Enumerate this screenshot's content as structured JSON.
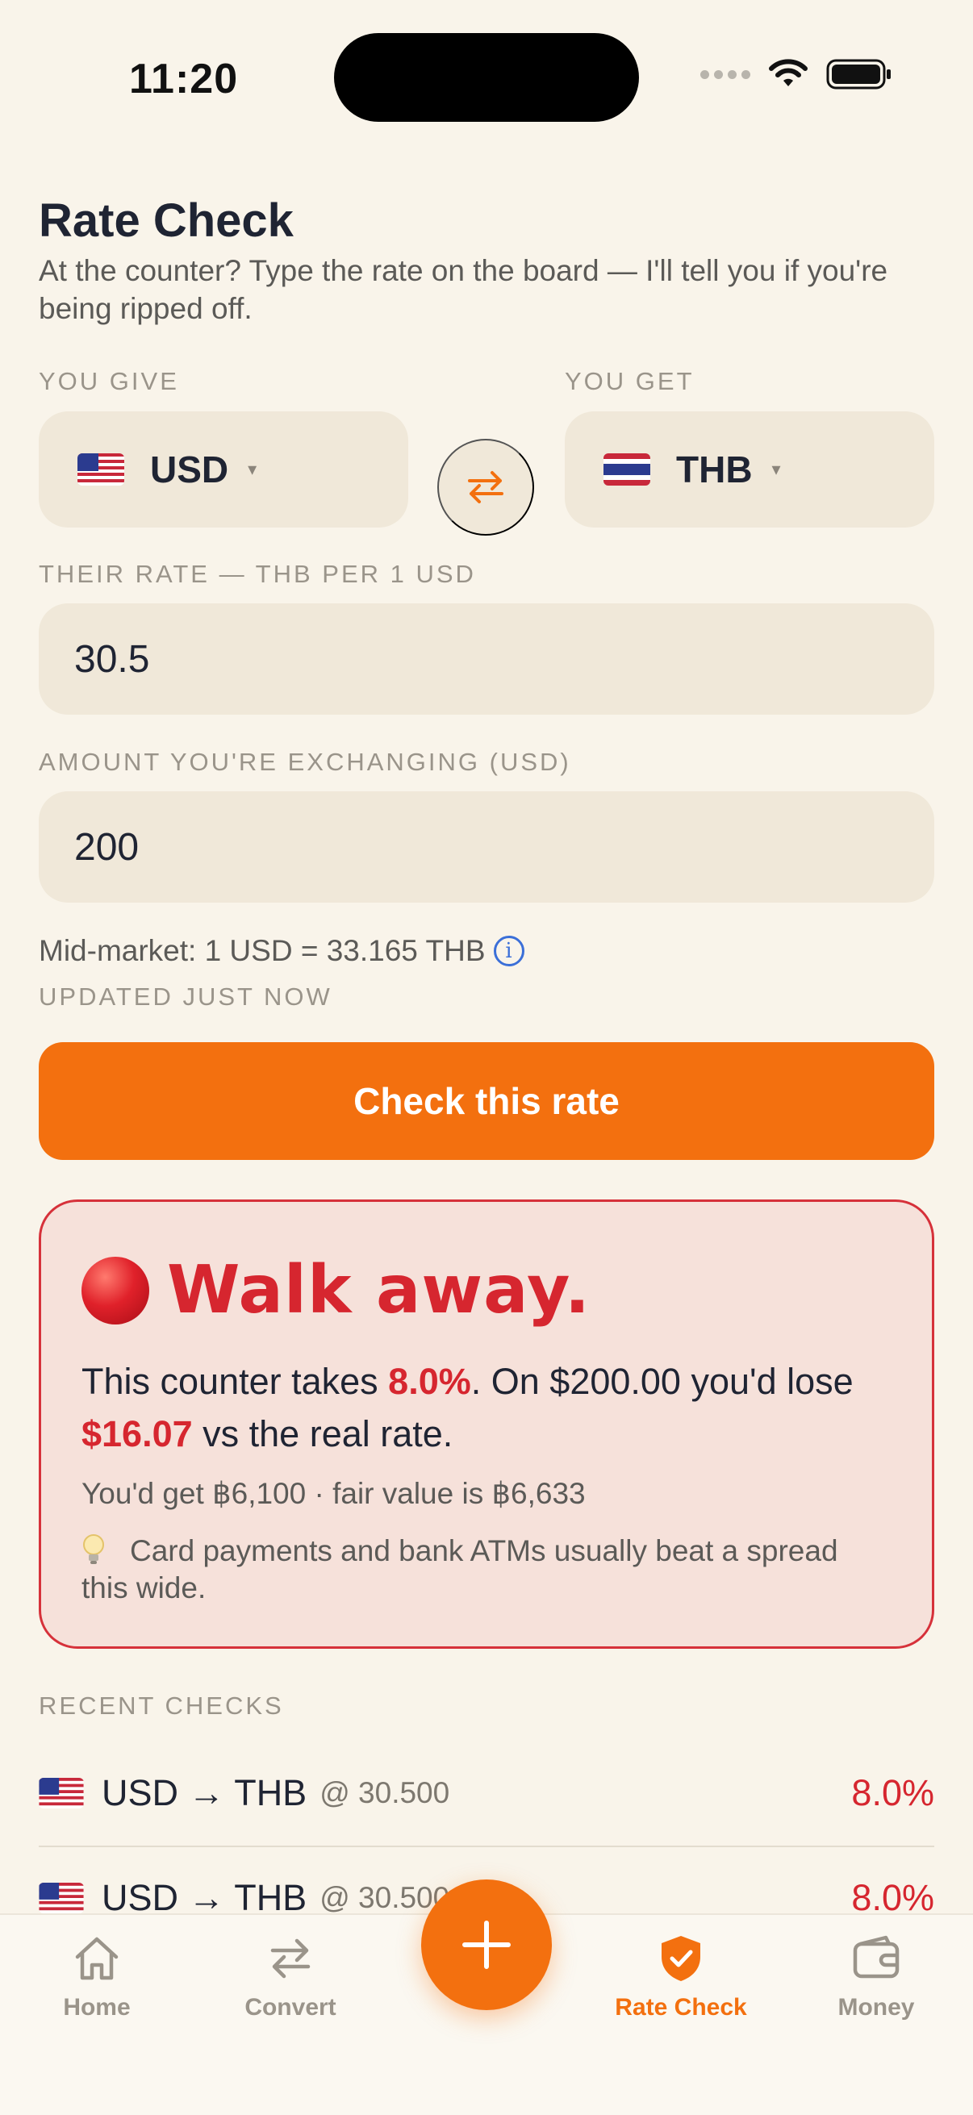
{
  "status_bar": {
    "time": "11:20"
  },
  "header": {
    "title": "Rate Check",
    "subtitle": "At the counter? Type the rate on the board — I'll tell you if you're being ripped off."
  },
  "give": {
    "label": "YOU GIVE",
    "currency": "USD",
    "caret": "▾"
  },
  "get": {
    "label": "YOU GET",
    "currency": "THB",
    "caret": "▾"
  },
  "rate_field": {
    "label": "THEIR RATE — THB PER 1 USD",
    "value": "30.5"
  },
  "amount_field": {
    "label": "AMOUNT YOU'RE EXCHANGING (USD)",
    "value": "200"
  },
  "mid_market": {
    "text": "Mid-market: 1 USD = 33.165 THB",
    "info_glyph": "i",
    "updated": "UPDATED JUST NOW"
  },
  "check_button": {
    "label": "Check this rate"
  },
  "result": {
    "verdict": "Walk away.",
    "body_prefix": "This counter takes ",
    "spread": "8.0%",
    "body_mid": ". On $200.00 you'd lose ",
    "loss": "$16.07",
    "body_suffix": " vs the real rate.",
    "detail": "You'd get ฿6,100 · fair value is ฿6,633",
    "tip": "Card payments and bank ATMs usually beat a spread this wide.",
    "accent_color": "#d6262f"
  },
  "recent": {
    "label": "RECENT CHECKS",
    "items": [
      {
        "pair": "USD → THB",
        "rate": "@ 30.500",
        "pct": "8.0%"
      },
      {
        "pair": "USD → THB",
        "rate": "@ 30.500",
        "pct": "8.0%"
      }
    ]
  },
  "tabs": [
    {
      "label": "Home",
      "icon": "home-icon"
    },
    {
      "label": "Convert",
      "icon": "swap-icon"
    },
    {
      "label": "Rate Check",
      "icon": "shield-check-icon",
      "active": true
    },
    {
      "label": "Money",
      "icon": "wallet-icon"
    }
  ],
  "fab": {
    "icon": "plus-icon"
  },
  "colors": {
    "accent": "#f3700f",
    "background": "#f9f4ea",
    "field": "#f0e8d9",
    "danger": "#d6262f"
  }
}
